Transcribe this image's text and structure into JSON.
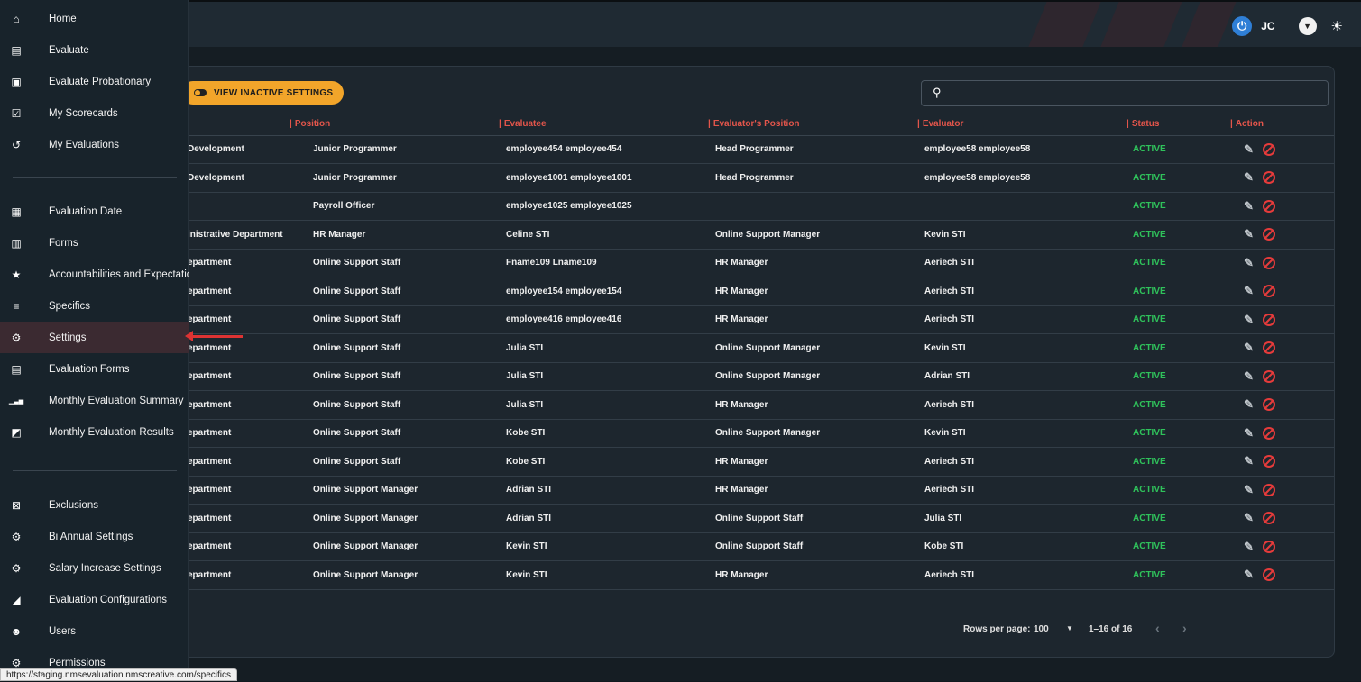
{
  "header": {
    "initials": "JC"
  },
  "toolbar": {
    "view_inactive_label": "VIEW INACTIVE SETTINGS",
    "search_placeholder": ""
  },
  "table": {
    "columns": [
      "Position",
      "Evaluatee",
      "Evaluator's Position",
      "Evaluator",
      "Status",
      "Action"
    ],
    "rows": [
      {
        "department": "Development",
        "position": "Junior Programmer",
        "evaluatee": "employee454 employee454",
        "evaluator_position": "Head Programmer",
        "evaluator": "employee58 employee58",
        "status": "ACTIVE"
      },
      {
        "department": "Development",
        "position": "Junior Programmer",
        "evaluatee": "employee1001 employee1001",
        "evaluator_position": "Head Programmer",
        "evaluator": "employee58 employee58",
        "status": "ACTIVE"
      },
      {
        "department": "",
        "position": "Payroll Officer",
        "evaluatee": "employee1025 employee1025",
        "evaluator_position": "",
        "evaluator": "",
        "status": "ACTIVE"
      },
      {
        "department": "inistrative Department",
        "position": "HR Manager",
        "evaluatee": "Celine STI",
        "evaluator_position": "Online Support Manager",
        "evaluator": "Kevin STI",
        "status": "ACTIVE"
      },
      {
        "department": "epartment",
        "position": "Online Support Staff",
        "evaluatee": "Fname109 Lname109",
        "evaluator_position": "HR Manager",
        "evaluator": "Aeriech STI",
        "status": "ACTIVE"
      },
      {
        "department": "epartment",
        "position": "Online Support Staff",
        "evaluatee": "employee154 employee154",
        "evaluator_position": "HR Manager",
        "evaluator": "Aeriech STI",
        "status": "ACTIVE"
      },
      {
        "department": "epartment",
        "position": "Online Support Staff",
        "evaluatee": "employee416 employee416",
        "evaluator_position": "HR Manager",
        "evaluator": "Aeriech STI",
        "status": "ACTIVE"
      },
      {
        "department": "epartment",
        "position": "Online Support Staff",
        "evaluatee": "Julia STI",
        "evaluator_position": "Online Support Manager",
        "evaluator": "Kevin STI",
        "status": "ACTIVE"
      },
      {
        "department": "epartment",
        "position": "Online Support Staff",
        "evaluatee": "Julia STI",
        "evaluator_position": "Online Support Manager",
        "evaluator": "Adrian STI",
        "status": "ACTIVE"
      },
      {
        "department": "epartment",
        "position": "Online Support Staff",
        "evaluatee": "Julia STI",
        "evaluator_position": "HR Manager",
        "evaluator": "Aeriech STI",
        "status": "ACTIVE"
      },
      {
        "department": "epartment",
        "position": "Online Support Staff",
        "evaluatee": "Kobe STI",
        "evaluator_position": "Online Support Manager",
        "evaluator": "Kevin STI",
        "status": "ACTIVE"
      },
      {
        "department": "epartment",
        "position": "Online Support Staff",
        "evaluatee": "Kobe STI",
        "evaluator_position": "HR Manager",
        "evaluator": "Aeriech STI",
        "status": "ACTIVE"
      },
      {
        "department": "epartment",
        "position": "Online Support Manager",
        "evaluatee": "Adrian STI",
        "evaluator_position": "HR Manager",
        "evaluator": "Aeriech STI",
        "status": "ACTIVE"
      },
      {
        "department": "epartment",
        "position": "Online Support Manager",
        "evaluatee": "Adrian STI",
        "evaluator_position": "Online Support Staff",
        "evaluator": "Julia STI",
        "status": "ACTIVE"
      },
      {
        "department": "epartment",
        "position": "Online Support Manager",
        "evaluatee": "Kevin STI",
        "evaluator_position": "Online Support Staff",
        "evaluator": "Kobe STI",
        "status": "ACTIVE"
      },
      {
        "department": "epartment",
        "position": "Online Support Manager",
        "evaluatee": "Kevin STI",
        "evaluator_position": "HR Manager",
        "evaluator": "Aeriech STI",
        "status": "ACTIVE"
      }
    ]
  },
  "pagination": {
    "rows_per_page_label": "Rows per page:",
    "rows_per_page_value": "100",
    "range": "1–16 of 16"
  },
  "sidebar": {
    "items": [
      {
        "label": "Home",
        "icon": "home-icon",
        "glyph": "⌂"
      },
      {
        "label": "Evaluate",
        "icon": "evaluate-icon",
        "glyph": "▤"
      },
      {
        "label": "Evaluate Probationary",
        "icon": "chat-icon",
        "glyph": "▣"
      },
      {
        "label": "My Scorecards",
        "icon": "clipboard-check-icon",
        "glyph": "☑"
      },
      {
        "label": "My Evaluations",
        "icon": "history-icon",
        "glyph": "↺"
      },
      {
        "label": "Evaluation Date",
        "icon": "calendar-icon",
        "glyph": "▦"
      },
      {
        "label": "Forms",
        "icon": "clipboard-icon",
        "glyph": "▥"
      },
      {
        "label": "Accountabilities and Expectatio",
        "icon": "star-icon",
        "glyph": "★"
      },
      {
        "label": "Specifics",
        "icon": "list-icon",
        "glyph": "≡"
      },
      {
        "label": "Settings",
        "icon": "gear-icon",
        "glyph": "⚙"
      },
      {
        "label": "Evaluation Forms",
        "icon": "library-icon",
        "glyph": "▤"
      },
      {
        "label": "Monthly Evaluation Summary",
        "icon": "bar-chart-icon",
        "glyph": "▁▃▅"
      },
      {
        "label": "Monthly Evaluation Results",
        "icon": "image-chart-icon",
        "glyph": "◩"
      },
      {
        "label": "Exclusions",
        "icon": "close-box-icon",
        "glyph": "⊠"
      },
      {
        "label": "Bi Annual Settings",
        "icon": "gear-icon",
        "glyph": "⚙"
      },
      {
        "label": "Salary Increase Settings",
        "icon": "gear-icon",
        "glyph": "⚙"
      },
      {
        "label": "Evaluation Configurations",
        "icon": "wrench-icon",
        "glyph": "◢"
      },
      {
        "label": "Users",
        "icon": "users-icon",
        "glyph": "☻"
      },
      {
        "label": "Permissions",
        "icon": "gear-icon",
        "glyph": "⚙"
      }
    ]
  },
  "status_bar": {
    "url": "https://staging.nmsevaluation.nmscreative.com/specifics"
  },
  "colors": {
    "accent": "#f2a52a",
    "header_red": "#e2554b",
    "active_green": "#2fc25b",
    "ban_red": "#e63b3b"
  }
}
